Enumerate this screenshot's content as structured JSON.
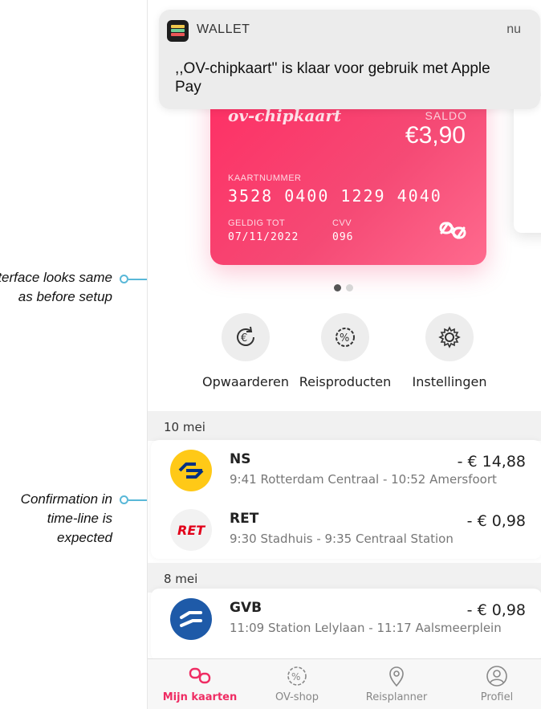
{
  "annotations": [
    {
      "text": "Interface looks same as before setup"
    },
    {
      "text": "Confirmation in time-line is expected"
    }
  ],
  "notification": {
    "app_name": "WALLET",
    "time": "nu",
    "message": ",,OV-chipkaart'' is klaar voor gebruik met Apple Pay"
  },
  "card": {
    "brand": "ov-chipkaart",
    "saldo_label": "SALDO",
    "saldo": "€3,90",
    "number_label": "KAARTNUMMER",
    "number": "3528 0400 1229 4040",
    "valid_label": "GELDIG TOT",
    "valid": "07/11/2022",
    "cvv_label": "CVV",
    "cvv": "096"
  },
  "actions": [
    {
      "label": "Opwaarderen",
      "icon": "euro-refresh-icon"
    },
    {
      "label": "Reisproducten",
      "icon": "percent-badge-icon"
    },
    {
      "label": "Instellingen",
      "icon": "gear-icon"
    }
  ],
  "timeline": [
    {
      "date": "10 mei",
      "trips": [
        {
          "operator": "NS",
          "detail": "9:41 Rotterdam Centraal - 10:52 Amersfoort",
          "amount": "- € 14,88",
          "logo_color": "#ffc917"
        },
        {
          "operator": "RET",
          "detail": "9:30 Stadhuis - 9:35 Centraal Station",
          "amount": "- €  0,98",
          "logo_color": "#f2f2f2"
        }
      ]
    },
    {
      "date": "8 mei",
      "trips": [
        {
          "operator": "GVB",
          "detail": "11:09 Station Lelylaan - 11:17 Aalsmeerplein",
          "amount": "- €  0,98",
          "logo_color": "#1e5aa8"
        }
      ]
    }
  ],
  "tabs": [
    {
      "label": "Mijn kaarten",
      "icon": "card-link-icon",
      "active": true
    },
    {
      "label": "OV-shop",
      "icon": "percent-badge-icon",
      "active": false
    },
    {
      "label": "Reisplanner",
      "icon": "map-pin-icon",
      "active": false
    },
    {
      "label": "Profiel",
      "icon": "person-icon",
      "active": false
    }
  ],
  "colors": {
    "accent": "#ef2c63",
    "annotation": "#59b8d8"
  }
}
